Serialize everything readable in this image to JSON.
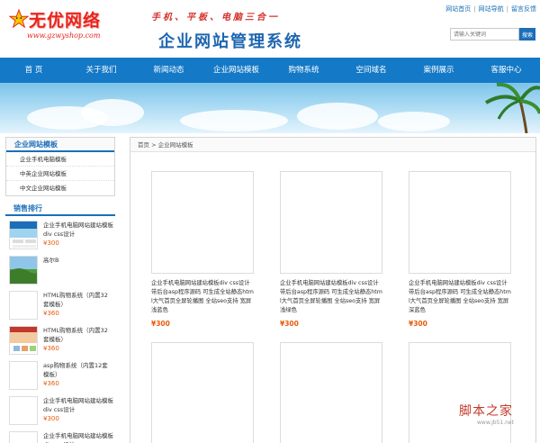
{
  "header": {
    "logo_text": "无优网络",
    "logo_url": "www.gzwyshop.com",
    "slogan": "手机、平板、电脑三合一",
    "site_title": "企业网站管理系统",
    "top_links": [
      "网站首页",
      "网站导航",
      "留言反馈"
    ],
    "search_placeholder": "请输入关键词",
    "search_button": "搜索"
  },
  "nav": [
    "首 页",
    "关于我们",
    "新闻动态",
    "企业网站模板",
    "购物系统",
    "空间域名",
    "案例展示",
    "客服中心"
  ],
  "sidebar": {
    "category_title": "企业网站模板",
    "categories": [
      "企业手机电脑模板",
      "中英企业网站模板",
      "中文企业网站模板"
    ],
    "sales_title": "销售排行",
    "sales": [
      {
        "name": "企业手机电脑网站建站模板div css设计",
        "price": "¥300"
      },
      {
        "name": "高尔B",
        "price": ""
      },
      {
        "name": "HTML购物系统（内置32套模板）",
        "price": "¥360"
      },
      {
        "name": "HTML购物系统（内置32套模板）",
        "price": "¥360"
      },
      {
        "name": "asp购物系统（内置12套模板）",
        "price": "¥360"
      },
      {
        "name": "企业手机电脑网站建站模板div css设计",
        "price": "¥300"
      },
      {
        "name": "企业手机电脑网站建站模板div css设计",
        "price": ""
      }
    ]
  },
  "content": {
    "breadcrumb_home": "首页",
    "breadcrumb_sep": ">",
    "breadcrumb_current": "企业网站模板",
    "products": [
      {
        "desc": "企业手机电脑网站建站模板div css设计 带后台asp程序源码 可生成全站静态html大气首页全屏轮播图 全站seo支持 宽屏浅蓝色",
        "price": "¥300"
      },
      {
        "desc": "企业手机电脑网站建站模板div css设计 带后台asp程序源码 可生成全站静态html大气首页全屏轮播图 全站seo支持 宽屏浅绿色",
        "price": "¥300"
      },
      {
        "desc": "企业手机电脑网站建站模板div css设计 带后台asp程序源码 可生成全站静态html大气首页全屏轮播图 全站seo支持 宽屏深蓝色",
        "price": "¥300"
      },
      {
        "desc": "",
        "price": ""
      },
      {
        "desc": "",
        "price": ""
      },
      {
        "desc": "",
        "price": ""
      }
    ]
  },
  "watermark": {
    "text": "脚本之家",
    "sub": "www.jb51.net"
  },
  "colors": {
    "brand_blue": "#1479c7",
    "price_orange": "#e85a0c",
    "logo_red": "#e8251d"
  }
}
